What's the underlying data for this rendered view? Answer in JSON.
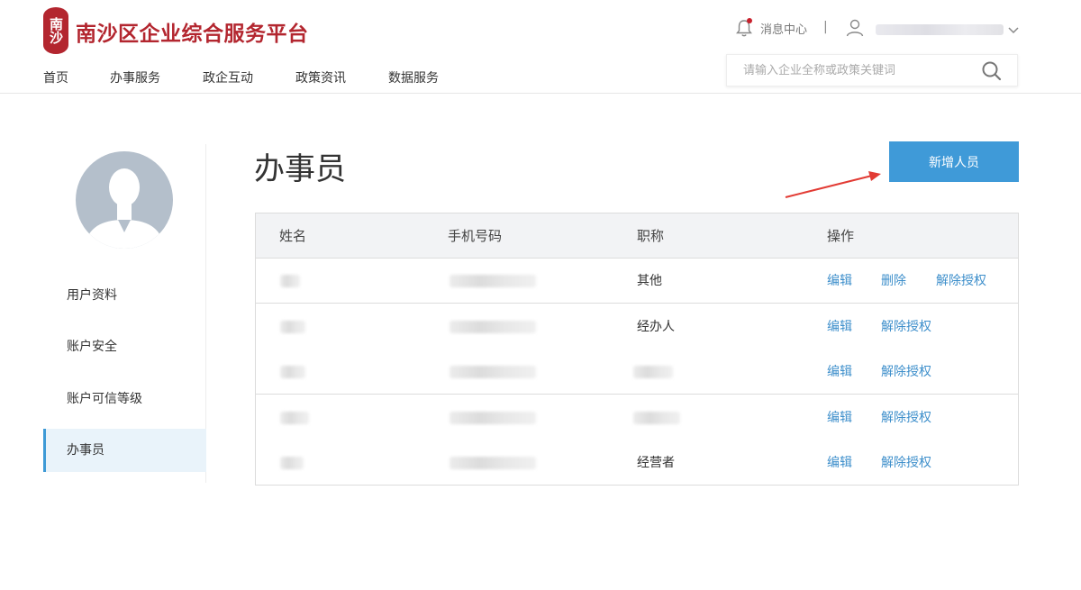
{
  "header": {
    "logo_text": "南沙",
    "site_title": "南沙区企业综合服务平台",
    "nav": [
      "首页",
      "办事服务",
      "政企互动",
      "政策资讯",
      "数据服务"
    ],
    "message_center": "消息中心",
    "separator": "|",
    "search_placeholder": "请输入企业全称或政策关键词"
  },
  "sidebar": {
    "items": [
      {
        "label": "用户资料",
        "active": false
      },
      {
        "label": "账户安全",
        "active": false
      },
      {
        "label": "账户可信等级",
        "active": false
      },
      {
        "label": "办事员",
        "active": true
      }
    ]
  },
  "main": {
    "title": "办事员",
    "add_button": "新增人员",
    "table": {
      "headers": [
        "姓名",
        "手机号码",
        "职称",
        "操作"
      ],
      "rows": [
        {
          "title": "其他",
          "actions": [
            "编辑",
            "删除",
            "解除授权"
          ]
        },
        {
          "title": "经办人",
          "actions": [
            "编辑",
            "解除授权"
          ]
        },
        {
          "title": "",
          "actions": [
            "编辑",
            "解除授权"
          ]
        },
        {
          "title": "",
          "actions": [
            "编辑",
            "解除授权"
          ]
        },
        {
          "title": "经营者",
          "actions": [
            "编辑",
            "解除授权"
          ]
        }
      ]
    }
  },
  "colors": {
    "brand_red": "#b3262f",
    "accent_blue": "#3f9ad8",
    "link_blue": "#3e8fcb",
    "annotation_red": "#e23b34"
  }
}
